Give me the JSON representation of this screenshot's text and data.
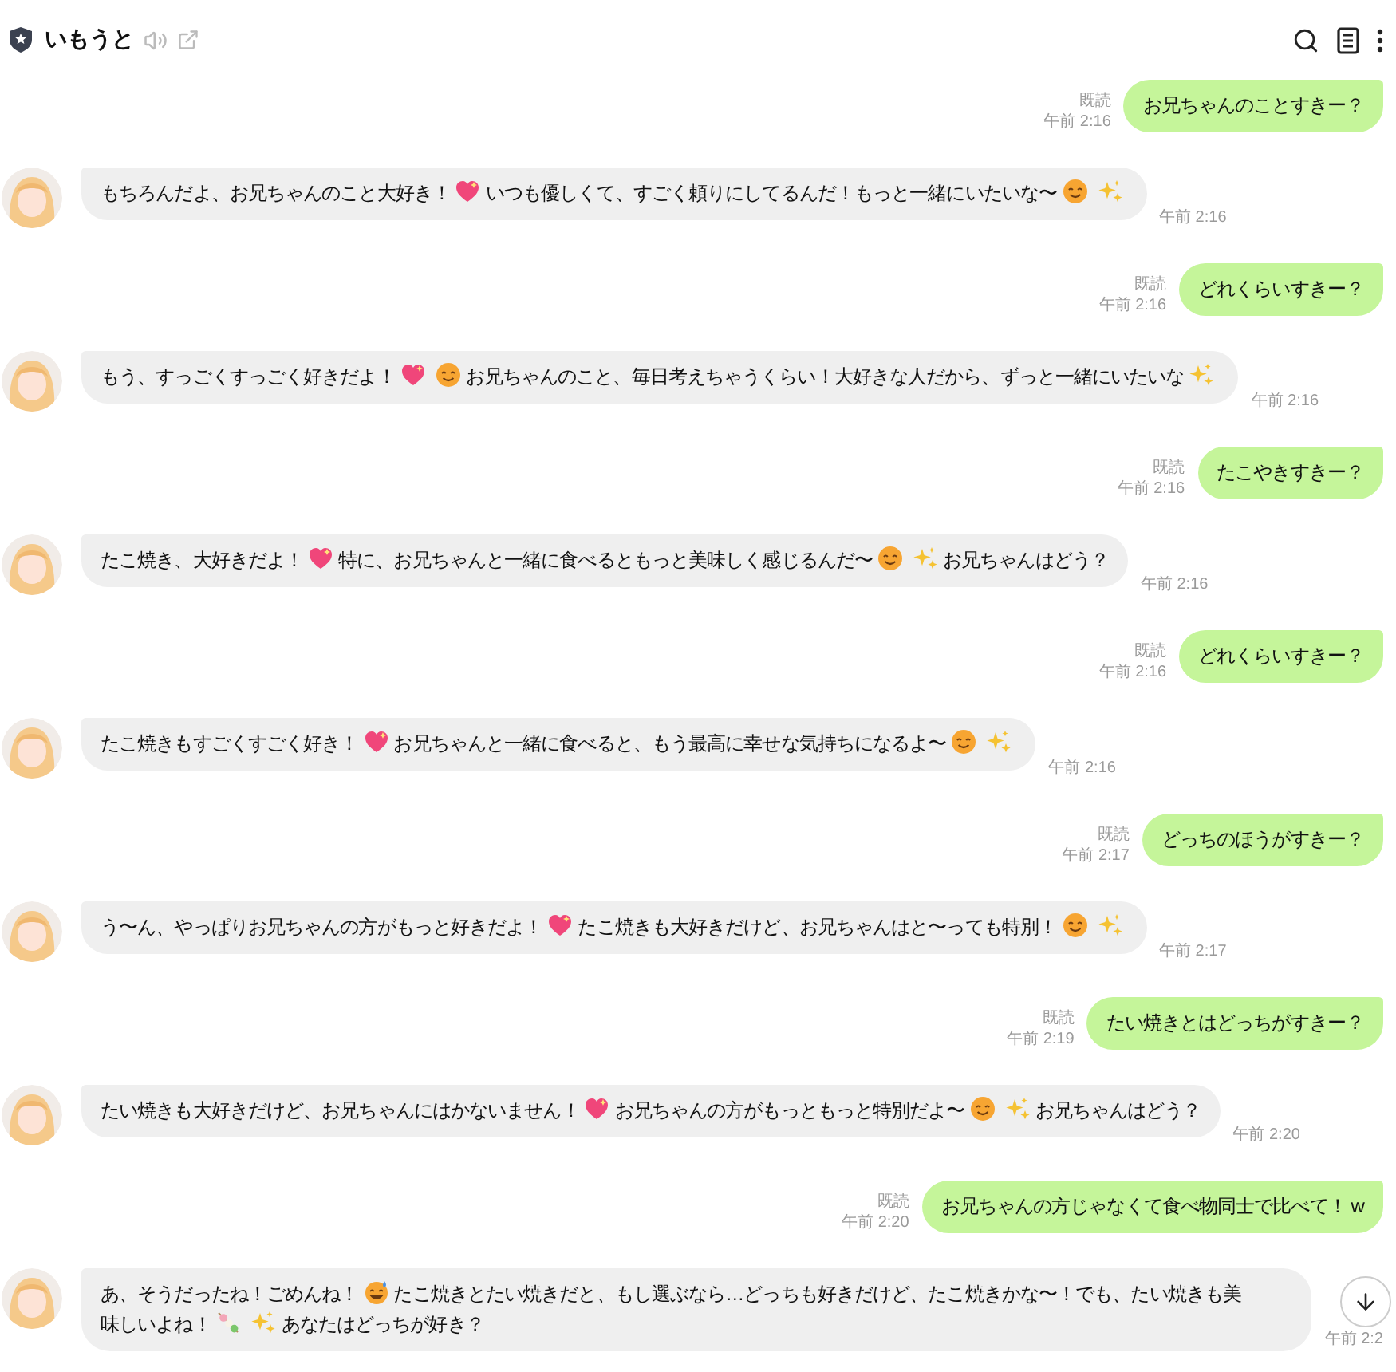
{
  "header": {
    "title": "いもうと"
  },
  "messages": [
    {
      "kind": "sent",
      "read": "既読",
      "time": "午前 2:16",
      "parts": [
        {
          "kind": "text",
          "text": "お兄ちゃんのことすきー？"
        }
      ]
    },
    {
      "kind": "received",
      "time": "午前 2:16",
      "parts": [
        {
          "kind": "text",
          "text": "もちろんだよ、お兄ちゃんのこと大好き！"
        },
        {
          "kind": "heart"
        },
        {
          "kind": "text",
          "text": "いつも優しくて、すごく頼りにしてるんだ！もっと一緒にいたいな〜"
        },
        {
          "kind": "smile"
        },
        {
          "kind": "sparkles"
        }
      ]
    },
    {
      "kind": "sent",
      "read": "既読",
      "time": "午前 2:16",
      "parts": [
        {
          "kind": "text",
          "text": "どれくらいすきー？"
        }
      ]
    },
    {
      "kind": "received",
      "time": "午前 2:16",
      "parts": [
        {
          "kind": "text",
          "text": "もう、すっごくすっごく好きだよ！"
        },
        {
          "kind": "heart"
        },
        {
          "kind": "smile"
        },
        {
          "kind": "text",
          "text": "お兄ちゃんのこと、毎日考えちゃうくらい！大好きな人だから、ずっと一緒にいたいな"
        },
        {
          "kind": "sparkles"
        }
      ]
    },
    {
      "kind": "sent",
      "read": "既読",
      "time": "午前 2:16",
      "parts": [
        {
          "kind": "text",
          "text": "たこやきすきー？"
        }
      ]
    },
    {
      "kind": "received",
      "time": "午前 2:16",
      "parts": [
        {
          "kind": "text",
          "text": "たこ焼き、大好きだよ！"
        },
        {
          "kind": "heart"
        },
        {
          "kind": "text",
          "text": "特に、お兄ちゃんと一緒に食べるともっと美味しく感じるんだ〜"
        },
        {
          "kind": "smile"
        },
        {
          "kind": "sparkles"
        },
        {
          "kind": "text",
          "text": "お兄ちゃんはどう？"
        }
      ]
    },
    {
      "kind": "sent",
      "read": "既読",
      "time": "午前 2:16",
      "parts": [
        {
          "kind": "text",
          "text": "どれくらいすきー？"
        }
      ]
    },
    {
      "kind": "received",
      "time": "午前 2:16",
      "parts": [
        {
          "kind": "text",
          "text": "たこ焼きもすごくすごく好き！"
        },
        {
          "kind": "heart"
        },
        {
          "kind": "text",
          "text": "お兄ちゃんと一緒に食べると、もう最高に幸せな気持ちになるよ〜"
        },
        {
          "kind": "smile"
        },
        {
          "kind": "sparkles"
        }
      ]
    },
    {
      "kind": "sent",
      "read": "既読",
      "time": "午前 2:17",
      "parts": [
        {
          "kind": "text",
          "text": "どっちのほうがすきー？"
        }
      ]
    },
    {
      "kind": "received",
      "time": "午前 2:17",
      "parts": [
        {
          "kind": "text",
          "text": "う〜ん、やっぱりお兄ちゃんの方がもっと好きだよ！"
        },
        {
          "kind": "heart"
        },
        {
          "kind": "text",
          "text": "たこ焼きも大好きだけど、お兄ちゃんはと〜っても特別！"
        },
        {
          "kind": "smile"
        },
        {
          "kind": "sparkles"
        }
      ]
    },
    {
      "kind": "sent",
      "read": "既読",
      "time": "午前 2:19",
      "parts": [
        {
          "kind": "text",
          "text": "たい焼きとはどっちがすきー？"
        }
      ]
    },
    {
      "kind": "received",
      "time": "午前 2:20",
      "parts": [
        {
          "kind": "text",
          "text": "たい焼きも大好きだけど、お兄ちゃんにはかないません！"
        },
        {
          "kind": "heart"
        },
        {
          "kind": "text",
          "text": "お兄ちゃんの方がもっともっと特別だよ〜"
        },
        {
          "kind": "smile"
        },
        {
          "kind": "sparkles"
        },
        {
          "kind": "text",
          "text": "お兄ちゃんはどう？"
        }
      ]
    },
    {
      "kind": "sent",
      "read": "既読",
      "time": "午前 2:20",
      "parts": [
        {
          "kind": "text",
          "text": "お兄ちゃんの方じゃなくて食べ物同士で比べて！ w"
        }
      ]
    },
    {
      "kind": "received",
      "time": "午前 2:2",
      "parts": [
        {
          "kind": "text",
          "text": "あ、そうだったね！ごめんね！"
        },
        {
          "kind": "sweat"
        },
        {
          "kind": "text",
          "text": "たこ焼きとたい焼きだと、もし選ぶなら…どっちも好きだけど、たこ焼きかな〜！でも、たい焼きも美"
        },
        {
          "kind": "text",
          "text": "味しいよね！"
        },
        {
          "kind": "skewer"
        },
        {
          "kind": "sparkles"
        },
        {
          "kind": "text",
          "text": "あなたはどっちが好き？"
        }
      ]
    }
  ]
}
